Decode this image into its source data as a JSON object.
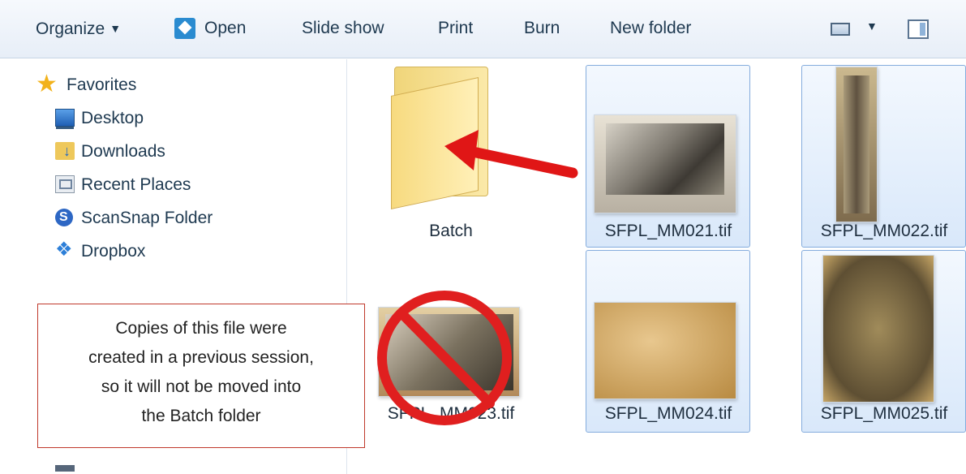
{
  "toolbar": {
    "organize_label": "Organize",
    "open_label": "Open",
    "slideshow_label": "Slide show",
    "print_label": "Print",
    "burn_label": "Burn",
    "new_folder_label": "New folder",
    "icons": [
      "open-icon",
      "view-icon",
      "preview-pane-icon"
    ]
  },
  "sidebar": {
    "items": [
      {
        "label": "Favorites",
        "icon": "star-icon"
      },
      {
        "label": "Desktop",
        "icon": "desktop-icon"
      },
      {
        "label": "Downloads",
        "icon": "downloads-icon"
      },
      {
        "label": "Recent Places",
        "icon": "recent-places-icon"
      },
      {
        "label": "ScanSnap Folder",
        "icon": "scansnap-icon"
      },
      {
        "label": "Dropbox",
        "icon": "dropbox-icon"
      }
    ]
  },
  "main": {
    "items": [
      {
        "name": "Batch",
        "type": "folder"
      },
      {
        "name": "SFPL_MM021.tif",
        "type": "image",
        "selected": true
      },
      {
        "name": "SFPL_MM022.tif",
        "type": "image",
        "selected": true
      },
      {
        "name": "SFPL_MM023.tif",
        "type": "image",
        "selected": false
      },
      {
        "name": "SFPL_MM024.tif",
        "type": "image",
        "selected": true
      },
      {
        "name": "SFPL_MM025.tif",
        "type": "image",
        "selected": true
      }
    ]
  },
  "annotation": {
    "lines": [
      "Copies of this file were",
      "created in a previous session,",
      "so it will not be moved into",
      "the Batch folder"
    ]
  },
  "colors": {
    "selection_border": "#84acdd",
    "arrow": "#e01616",
    "no_symbol": "#e01f1f",
    "callout_border": "#c0392b"
  }
}
